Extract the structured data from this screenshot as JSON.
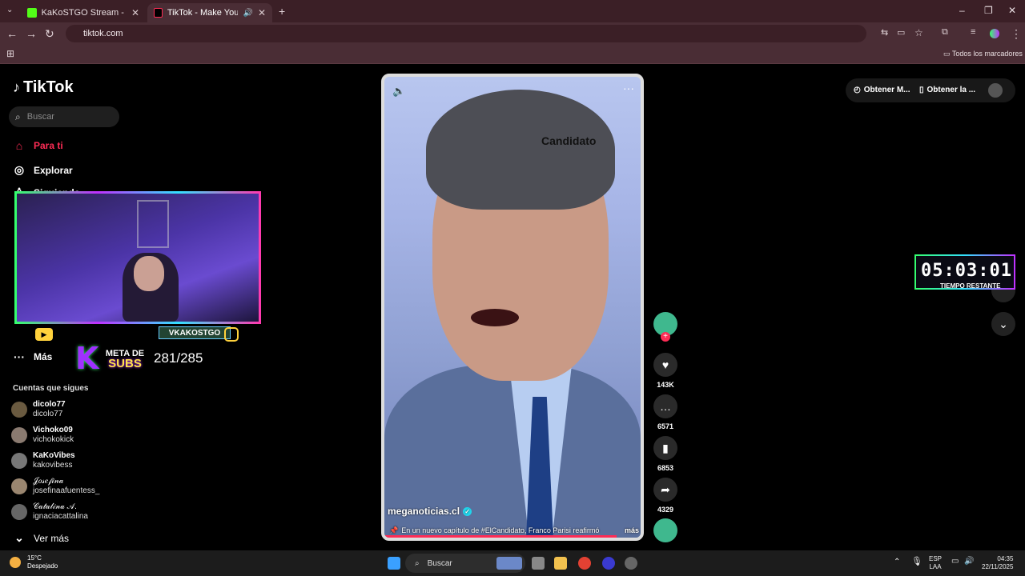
{
  "browser": {
    "tabs": [
      {
        "label": "KaKoSTGO Stream - Watch Live",
        "active": false
      },
      {
        "label": "TikTok - Make Your Day",
        "active": true
      }
    ],
    "url": "tiktok.com",
    "bookmarks_label": "Todos los marcadores"
  },
  "tiktok": {
    "logo": "TikTok",
    "search_placeholder": "Buscar",
    "nav": [
      {
        "label": "Para ti",
        "icon": "home-icon",
        "active": true
      },
      {
        "label": "Explorar",
        "icon": "compass-icon"
      },
      {
        "label": "Siguiendo",
        "icon": "user-icon"
      },
      {
        "label": "Más",
        "icon": "more-icon"
      }
    ],
    "following_title": "Cuentas que sigues",
    "following": [
      {
        "name": "dicolo77",
        "user": "dicolo77"
      },
      {
        "name": "Vichoko09",
        "user": "vichokokick"
      },
      {
        "name": "KaKoVibes",
        "user": "kakovibess"
      },
      {
        "name": "𝒥𝑜𝓈𝑒𝒻𝒾𝓃𝒶",
        "user": "josefinaafuentess_"
      },
      {
        "name": "𝒞𝒶𝓉𝒶𝓁𝒾𝓃𝒶 𝒜.",
        "user": "ignaciacattalina"
      }
    ],
    "ver_mas": "Ver más",
    "top_buttons": [
      "Obtener M...",
      "Obtener la ..."
    ],
    "video": {
      "author": "meganoticias.cl",
      "description": "En un nuevo capítulo de #ElCandidato, Franco Parisi reafirmó",
      "more": "más",
      "stamp": "Candidato"
    },
    "actions": {
      "likes": "143K",
      "comments": "6571",
      "saves": "6853",
      "shares": "4329"
    }
  },
  "overlay": {
    "channel": "VKAKOSTGO",
    "meta_line1": "META DE",
    "meta_line2": "SUBS",
    "subs_count": "281/285",
    "timer": "05:03:01",
    "timer_label": "TIEMPO RESTANTE"
  },
  "taskbar": {
    "temp": "15°C",
    "weather": "Despejado",
    "search": "Buscar",
    "lang1": "ESP",
    "lang2": "LAA",
    "time": "04:35",
    "date": "22/11/2025"
  },
  "colors": {
    "accent": "#fe2c55",
    "chrome": "#3b1f26"
  }
}
